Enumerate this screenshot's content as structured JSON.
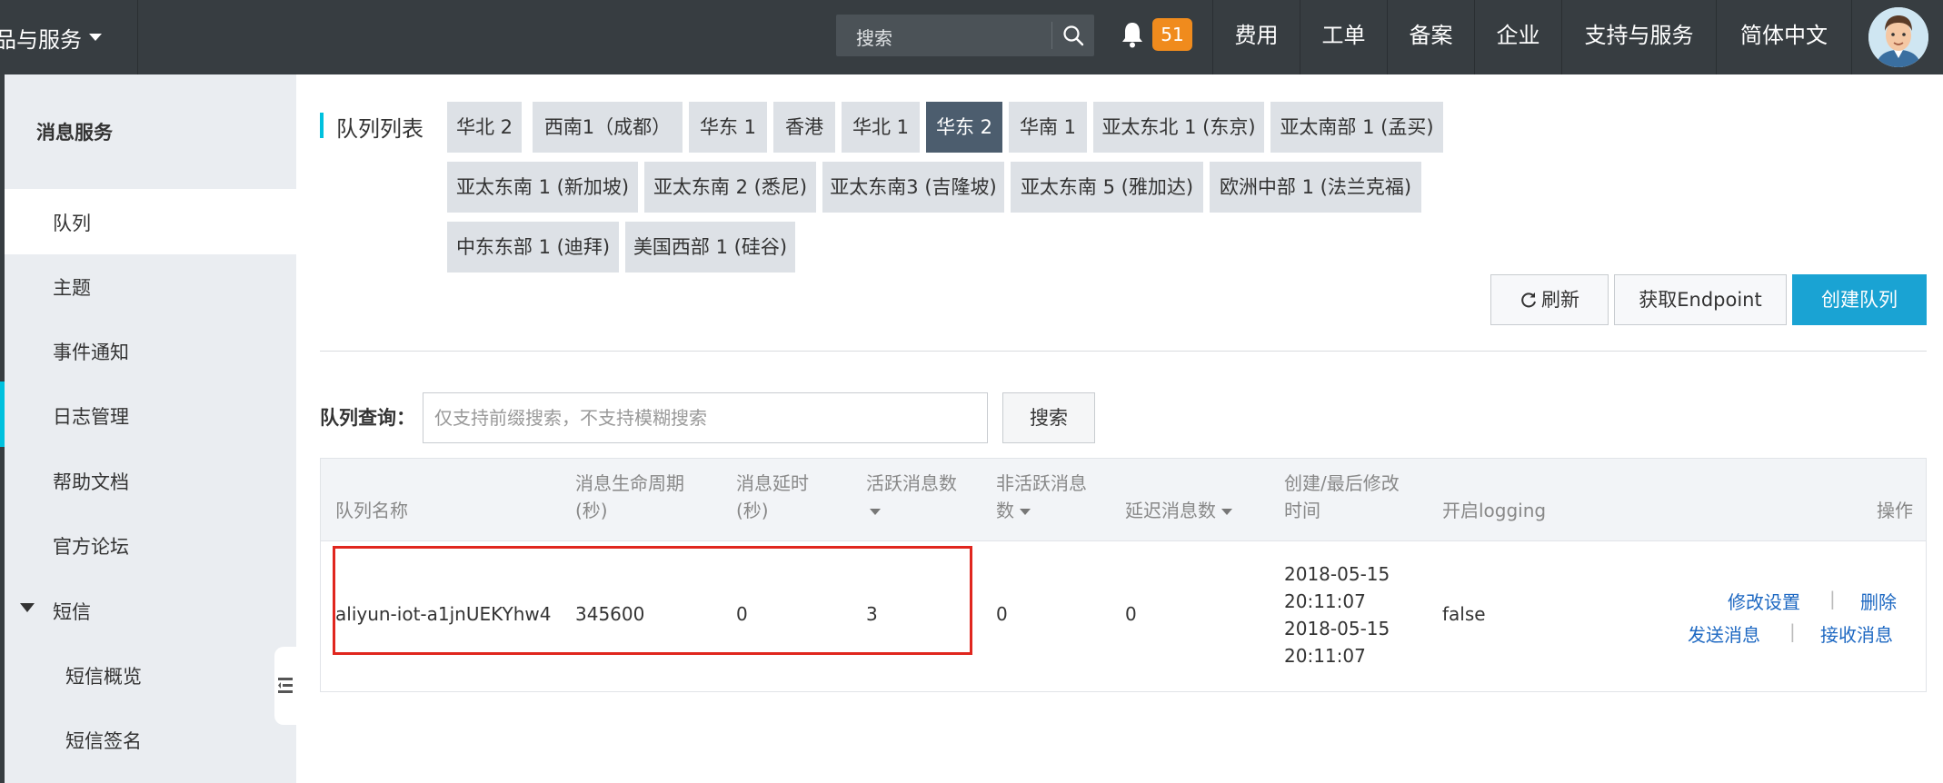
{
  "topbar": {
    "product_label": "品与服务",
    "search_placeholder": "搜索",
    "notification_count": "51",
    "nav": [
      "费用",
      "工单",
      "备案",
      "企业",
      "支持与服务",
      "简体中文"
    ]
  },
  "sidebar": {
    "title": "消息服务",
    "items": [
      "队列",
      "主题",
      "事件通知",
      "日志管理",
      "帮助文档",
      "官方论坛"
    ],
    "group": "短信",
    "sub_items": [
      "短信概览",
      "短信签名"
    ]
  },
  "main": {
    "title": "队列列表",
    "regions": [
      "华北 2",
      "西南1（成都）",
      "华东 1",
      "香港",
      "华北 1",
      "华东 2",
      "华南 1",
      "亚太东北 1 (东京)",
      "亚太南部 1 (孟买)",
      "亚太东南 1 (新加坡)",
      "亚太东南 2 (悉尼)",
      "亚太东南3 (吉隆坡)",
      "亚太东南 5 (雅加达)",
      "欧洲中部 1 (法兰克福)",
      "中东东部 1 (迪拜)",
      "美国西部 1 (硅谷)"
    ],
    "active_region": "华东 2",
    "buttons": {
      "refresh": "刷新",
      "endpoint": "获取Endpoint",
      "create": "创建队列"
    },
    "query": {
      "label": "队列查询：",
      "placeholder": "仅支持前缀搜索，不支持模糊搜索",
      "button": "搜索"
    },
    "table": {
      "headers": {
        "name": "队列名称",
        "lifecycle_1": "消息生命周期",
        "lifecycle_2": "(秒)",
        "delay_1": "消息延时",
        "delay_2": "(秒)",
        "active": "活跃消息数",
        "inactive_1": "非活跃消息",
        "inactive_2": "数",
        "delayed": "延迟消息数",
        "time_1": "创建/最后修改",
        "time_2": "时间",
        "logging": "开启logging",
        "ops": "操作"
      },
      "rows": [
        {
          "name": "aliyun-iot-a1jnUEKYhw4",
          "lifecycle": "345600",
          "delay": "0",
          "active": "3",
          "inactive": "0",
          "delayed": "0",
          "created_date": "2018-05-15",
          "created_time": "20:11:07",
          "modified_date": "2018-05-15",
          "modified_time": "20:11:07",
          "logging": "false",
          "op_modify": "修改设置",
          "op_delete": "删除",
          "op_send": "发送消息",
          "op_receive": "接收消息"
        }
      ]
    }
  },
  "colors": {
    "topbar_bg": "#373d41",
    "accent": "#00c1de",
    "primary_button": "#1aa3d3",
    "active_region": "#4c5d6e",
    "badge": "#f08b1d",
    "highlight_box": "#e0261e",
    "link": "#1d68c2"
  }
}
